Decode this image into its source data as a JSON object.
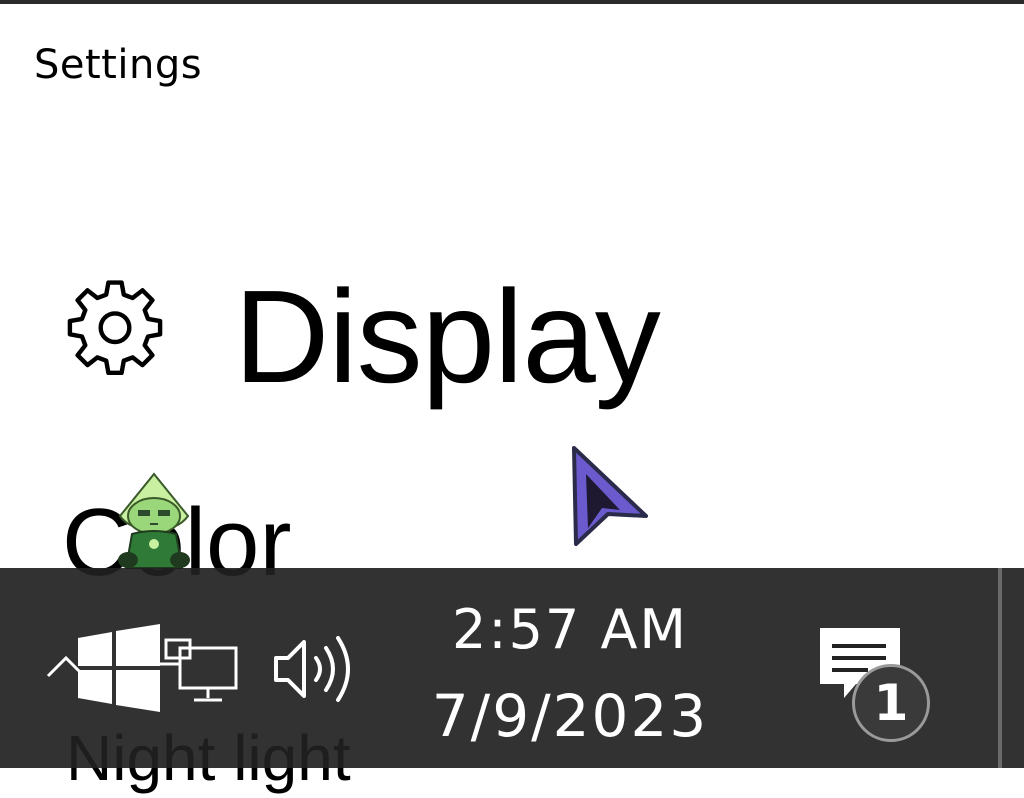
{
  "window": {
    "title": "Settings"
  },
  "page": {
    "title": "Display",
    "icon": "gear-icon"
  },
  "nav": {
    "items": [
      {
        "label": "Color"
      },
      {
        "label": "Night light"
      }
    ]
  },
  "taskbar": {
    "start_icon": "windows-logo-icon",
    "network_icon": "network-icon",
    "volume_icon": "volume-icon",
    "clock": {
      "time": "2:57 AM",
      "date": "7/9/2023"
    },
    "notifications": {
      "icon": "action-center-icon",
      "count": "1"
    }
  },
  "colors": {
    "taskbar_bg": "#212121",
    "cursor_fill": "#6a5acd",
    "sticker_green": "#8fd16a"
  }
}
